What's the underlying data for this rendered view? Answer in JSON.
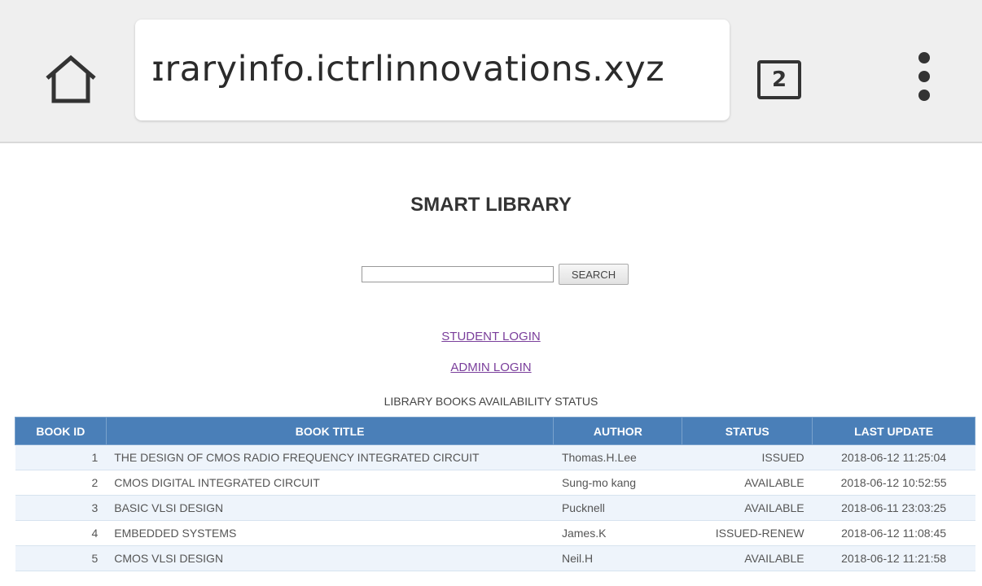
{
  "browser": {
    "url": "ɪraryinfo.ictrlinnovations.xyz",
    "tab_count": "2",
    "home_icon": "home-icon",
    "menu_icon": "more-vert-icon"
  },
  "page": {
    "title": "SMART LIBRARY",
    "search": {
      "value": "",
      "button_label": "SEARCH"
    },
    "links": {
      "student_login": "STUDENT LOGIN",
      "admin_login": "ADMIN LOGIN"
    },
    "caption": "LIBRARY BOOKS AVAILABILITY STATUS"
  },
  "table": {
    "columns": [
      "BOOK ID",
      "BOOK TITLE",
      "AUTHOR",
      "STATUS",
      "LAST UPDATE"
    ],
    "rows": [
      {
        "id": "1",
        "title": "THE DESIGN OF CMOS RADIO FREQUENCY INTEGRATED CIRCUIT",
        "author": "Thomas.H.Lee",
        "status": "ISSUED",
        "updated": "2018-06-12 11:25:04"
      },
      {
        "id": "2",
        "title": "CMOS DIGITAL INTEGRATED CIRCUIT",
        "author": "Sung-mo kang",
        "status": "AVAILABLE",
        "updated": "2018-06-12 10:52:55"
      },
      {
        "id": "3",
        "title": "BASIC VLSI DESIGN",
        "author": "Pucknell",
        "status": "AVAILABLE",
        "updated": "2018-06-11 23:03:25"
      },
      {
        "id": "4",
        "title": "EMBEDDED SYSTEMS",
        "author": "James.K",
        "status": "ISSUED-RENEW",
        "updated": "2018-06-12 11:08:45"
      },
      {
        "id": "5",
        "title": "CMOS VLSI DESIGN",
        "author": "Neil.H",
        "status": "AVAILABLE",
        "updated": "2018-06-12 11:21:58"
      }
    ]
  },
  "colors": {
    "header_bg": "#4a7fb8",
    "link": "#7a3e9b",
    "row_alt": "#eef4fb"
  }
}
